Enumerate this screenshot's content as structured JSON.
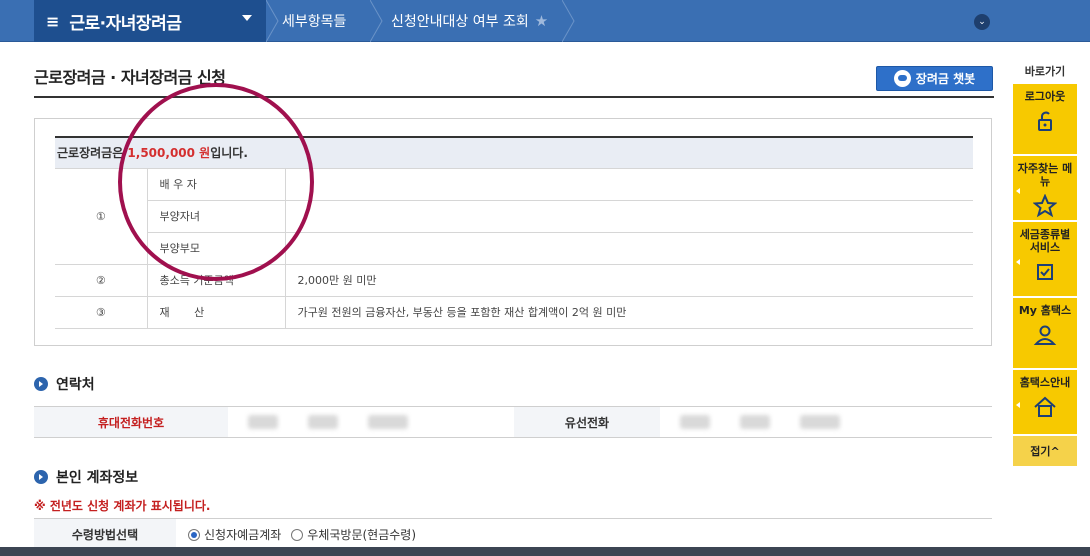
{
  "nav": {
    "main_menu": "근로·자녀장려금",
    "crumb1": "세부항목들",
    "crumb2": "신청안내대상 여부 조회"
  },
  "page": {
    "title": "근로장려금 · 자녀장려금 신청",
    "chatbot_label": "장려금 챗봇"
  },
  "info": {
    "summary_prefix": "근로장려금은 ",
    "amount": "1,500,000 원",
    "summary_suffix": "입니다.",
    "rows": [
      {
        "num": "①",
        "label": "배 우 자",
        "value": ""
      },
      {
        "num": "",
        "label": "부양자녀",
        "value": ""
      },
      {
        "num": "",
        "label": "부양부모",
        "value": ""
      },
      {
        "num": "②",
        "label": "총소득 기준금액",
        "value": "2,000만 원 미만"
      },
      {
        "num": "③",
        "label": "재       산",
        "value": "가구원 전원의 금융자산, 부동산 등을 포함한 재산 합계액이 2억 원 미만"
      }
    ]
  },
  "contact": {
    "section_title": "연락처",
    "mobile_label": "휴대전화번호",
    "landline_label": "유선전화"
  },
  "account": {
    "section_title": "본인 계좌정보",
    "notice": "※ 전년도 신청 계좌가 표시됩니다.",
    "method_label": "수령방법선택",
    "option1": "신청자예금계좌",
    "option2": "우체국방문(현금수령)"
  },
  "quick": {
    "title": "바로가기",
    "items": [
      "로그아웃",
      "자주찾는 메뉴",
      "세금종류별 서비스",
      "My 홈택스",
      "홈택스안내"
    ],
    "close": "접기^"
  },
  "colors": {
    "nav_blue": "#3a6fb3",
    "accent_red": "#d42f2f",
    "quick_yellow": "#f7c900",
    "annotation": "#a0104e"
  }
}
